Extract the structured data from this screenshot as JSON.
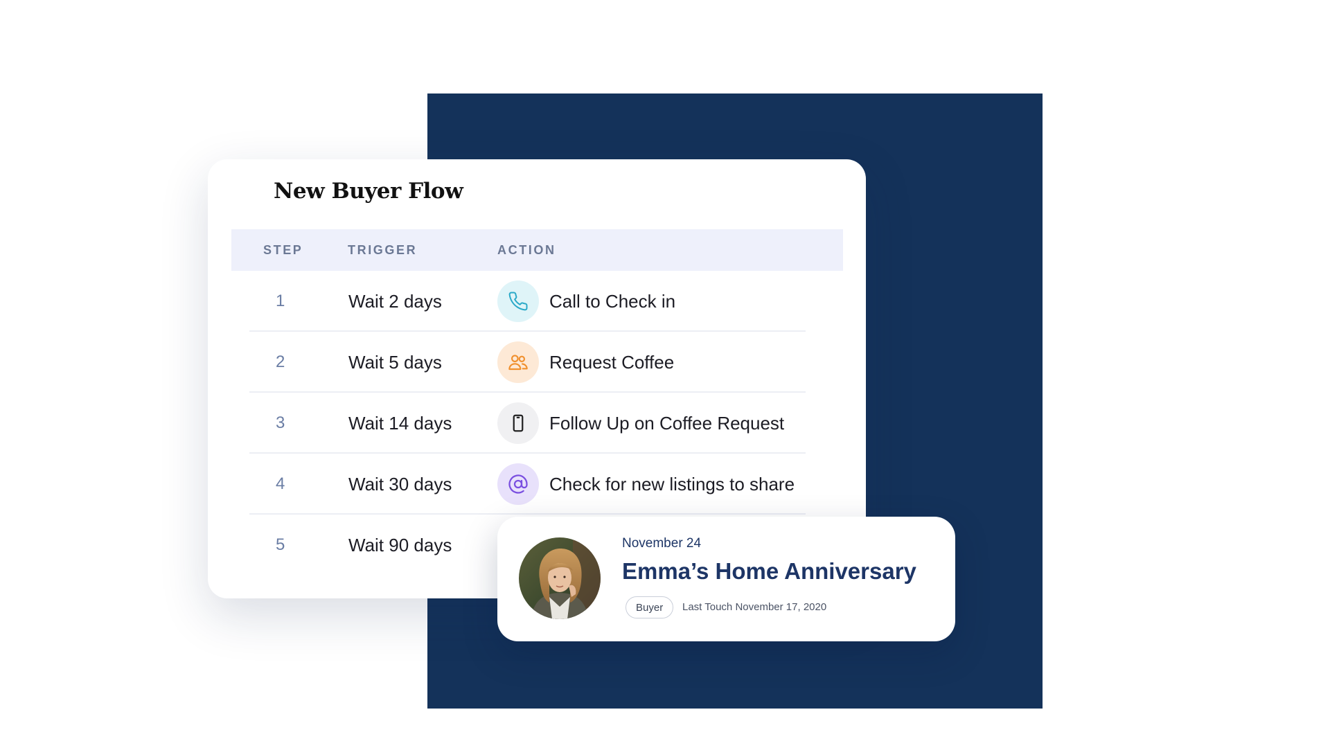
{
  "flow": {
    "title": "New Buyer Flow",
    "columns": {
      "step": "STEP",
      "trigger": "TRIGGER",
      "action": "ACTION"
    },
    "rows": [
      {
        "step": "1",
        "trigger": "Wait 2 days",
        "action": "Call to Check in",
        "icon": "phone-icon",
        "icon_bg": "#dff4f8",
        "icon_color": "#2aa9c8"
      },
      {
        "step": "2",
        "trigger": "Wait 5 days",
        "action": "Request Coffee",
        "icon": "people-icon",
        "icon_bg": "#fde9d6",
        "icon_color": "#f0902e"
      },
      {
        "step": "3",
        "trigger": "Wait 14 days",
        "action": "Follow Up on Coffee Request",
        "icon": "mobile-phone-icon",
        "icon_bg": "#f0f0f2",
        "icon_color": "#222222"
      },
      {
        "step": "4",
        "trigger": "Wait 30 days",
        "action": "Check for new listings to share",
        "icon": "at-sign-icon",
        "icon_bg": "#e8e1fb",
        "icon_color": "#7a4fe0"
      },
      {
        "step": "5",
        "trigger": "Wait 90 days",
        "action": "",
        "icon": "",
        "icon_bg": "",
        "icon_color": ""
      }
    ]
  },
  "event": {
    "date": "November 24",
    "title": "Emma’s Home Anniversary",
    "badge": "Buyer",
    "last_touch": "Last Touch November 17, 2020"
  },
  "colors": {
    "navy_block": "#14325a",
    "header_bg": "#eef0fb",
    "step_number": "#6a7da4",
    "event_text": "#1d3566"
  }
}
